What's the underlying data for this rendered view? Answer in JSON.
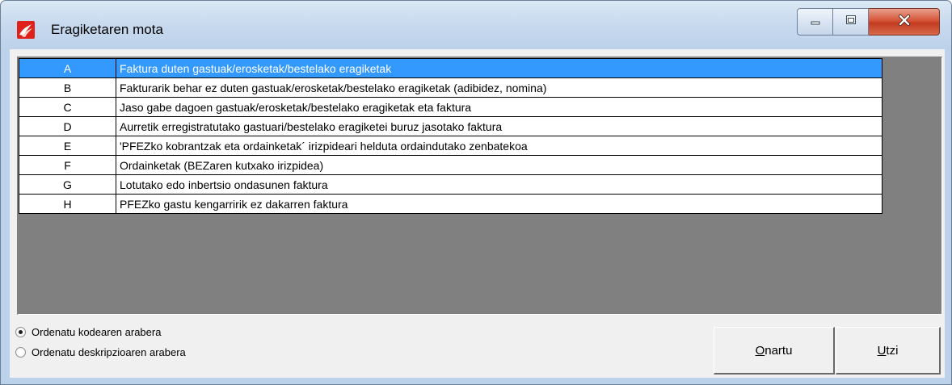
{
  "window": {
    "title": "Eragiketaren mota",
    "controls": {
      "minimize_icon": "minimize-icon",
      "maximize_icon": "maximize-icon",
      "close_icon": "close-icon"
    },
    "app_icon": "app-icon",
    "close_color": "#c9452a"
  },
  "list": {
    "selected_index": 0,
    "selection_color": "#3399ff",
    "rows": [
      {
        "code": "A",
        "description": "Faktura duten gastuak/erosketak/bestelako eragiketak"
      },
      {
        "code": "B",
        "description": "Fakturarik behar ez duten gastuak/erosketak/bestelako eragiketak (adibidez, nomina)"
      },
      {
        "code": "C",
        "description": "Jaso gabe dagoen gastuak/erosketak/bestelako eragiketak eta faktura"
      },
      {
        "code": "D",
        "description": "Aurretik erregistratutako gastuari/bestelako eragiketei buruz jasotako faktura"
      },
      {
        "code": "E",
        "description": "'PFEZko kobrantzak eta ordainketak´ irizpideari helduta ordaindutako zenbatekoa"
      },
      {
        "code": "F",
        "description": "Ordainketak (BEZaren kutxako irizpidea)"
      },
      {
        "code": "G",
        "description": "Lotutako edo inbertsio ondasunen faktura"
      },
      {
        "code": "H",
        "description": "PFEZko gastu kengarririk ez dakarren faktura"
      }
    ]
  },
  "sort": {
    "by_code": {
      "label": "Ordenatu kodearen arabera",
      "checked": true
    },
    "by_description": {
      "label": "Ordenatu deskripzioaren arabera",
      "checked": false
    }
  },
  "buttons": {
    "ok": {
      "mnemonic": "O",
      "rest": "nartu"
    },
    "cancel": {
      "mnemonic": "U",
      "rest": "tzi"
    }
  }
}
